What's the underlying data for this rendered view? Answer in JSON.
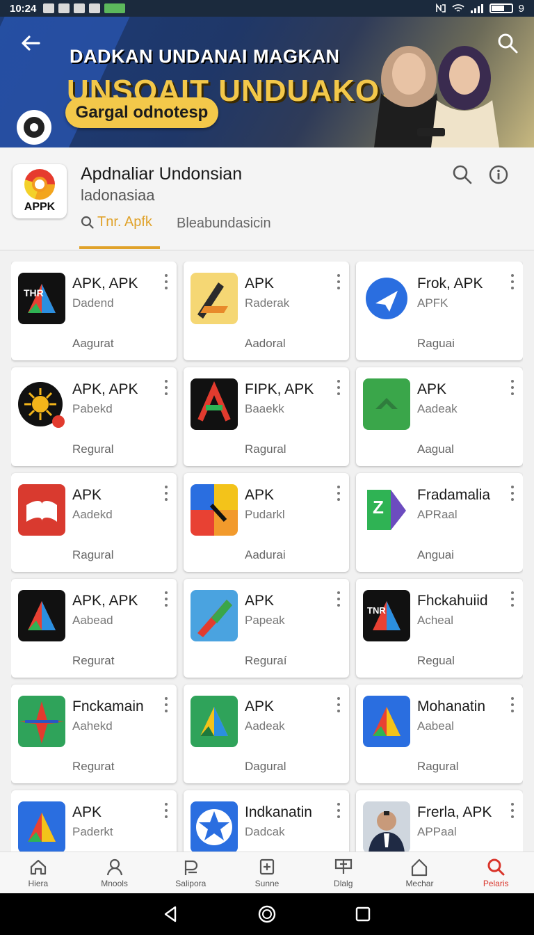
{
  "status_bar": {
    "time": "10:24",
    "battery": "9"
  },
  "banner": {
    "title_line1": "DADKAN UNDANAI MAGKAN",
    "title_line2": "UNSOAIT UNDUAKOSI",
    "cta_label": "Gargal odnotesp"
  },
  "app": {
    "icon_label": "APPK",
    "name": "Apdnaliar Undonsian",
    "subtitle": "ladonasiaa",
    "tabs": [
      {
        "label": "Tnr. Apfk",
        "active": true
      },
      {
        "label": "Bleabundasicin",
        "active": false
      }
    ]
  },
  "cards": [
    {
      "title": "APK, APK",
      "sub": "Dadend",
      "cat": "Aagurat",
      "icon": "ad-icon-black-multicolor"
    },
    {
      "title": "APK",
      "sub": "Raderak",
      "cat": "Aadoral",
      "icon": "pen-yellow-icon"
    },
    {
      "title": "Frok, APK",
      "sub": "APFK",
      "cat": "Raguai",
      "icon": "blue-plane-icon"
    },
    {
      "title": "APK, APK",
      "sub": "Pabekd",
      "cat": "Regural",
      "icon": "sun-icon"
    },
    {
      "title": "FIPK, APK",
      "sub": "Baaekk",
      "cat": "Ragural",
      "icon": "red-green-a-icon"
    },
    {
      "title": "APK",
      "sub": "Aadeak",
      "cat": "Aagual",
      "icon": "green-arrow-icon"
    },
    {
      "title": "APK",
      "sub": "Aadekd",
      "cat": "Ragural",
      "icon": "red-book-icon"
    },
    {
      "title": "APK",
      "sub": "Pudarkl",
      "cat": "Aadurai",
      "icon": "colorful-tiles-icon"
    },
    {
      "title": "Fradamalia",
      "sub": "APRaal",
      "cat": "Anguai",
      "icon": "green-z-icon"
    },
    {
      "title": "APK, APK",
      "sub": "Aabead",
      "cat": "Regurat",
      "icon": "drive-dark-icon"
    },
    {
      "title": "APK",
      "sub": "Papeak",
      "cat": "Reguraí",
      "icon": "pencil-blue-icon"
    },
    {
      "title": "Fhckahuiid",
      "sub": "Acheal",
      "cat": "Regual",
      "icon": "black-logo-icon"
    },
    {
      "title": "Fnckamain",
      "sub": "Aahekd",
      "cat": "Regurat",
      "icon": "green-compass-icon"
    },
    {
      "title": "APK",
      "sub": "Aadeak",
      "cat": "Dagural",
      "icon": "green-drive-icon"
    },
    {
      "title": "Mohanatin",
      "sub": "Aabeal",
      "cat": "Ragural",
      "icon": "blue-drive-icon"
    },
    {
      "title": "APK",
      "sub": "Paderkt",
      "cat": "",
      "icon": "drive-blue-icon"
    },
    {
      "title": "Indkanatin",
      "sub": "Dadcak",
      "cat": "",
      "icon": "star-blue-icon"
    },
    {
      "title": "Frerla, APK",
      "sub": "APPaal",
      "cat": "",
      "icon": "portrait-icon"
    }
  ],
  "bottom_nav": [
    {
      "label": "Hiera",
      "icon": "home-icon",
      "active": false
    },
    {
      "label": "Mnools",
      "icon": "person-icon",
      "active": false
    },
    {
      "label": "Salipora",
      "icon": "money-icon",
      "active": false
    },
    {
      "label": "Sunne",
      "icon": "plus-box-icon",
      "active": false
    },
    {
      "label": "Dlalg",
      "icon": "grid-icon",
      "active": false
    },
    {
      "label": "Mechar",
      "icon": "house-icon",
      "active": false
    },
    {
      "label": "Pelaris",
      "icon": "search-icon",
      "active": true
    }
  ],
  "colors": {
    "accent": "#e0a22a",
    "active_nav": "#d9342a"
  }
}
